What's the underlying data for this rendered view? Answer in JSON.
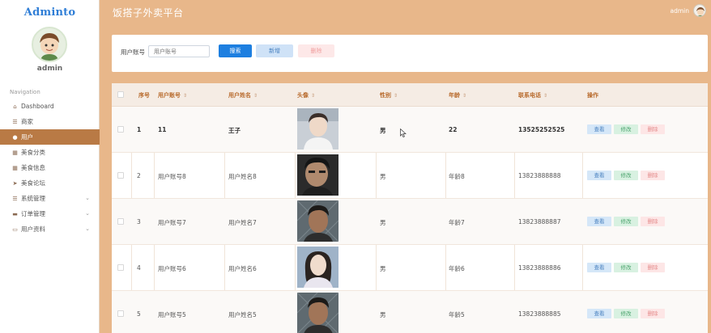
{
  "sidebar": {
    "brand": "Adminto",
    "admin_name": "admin",
    "nav_title": "Navigation",
    "items": [
      {
        "label": "Dashboard",
        "icon": "home-icon"
      },
      {
        "label": "商家",
        "icon": "list-icon"
      },
      {
        "label": "用户",
        "icon": "user-icon",
        "active": true
      },
      {
        "label": "美食分类",
        "icon": "grid-icon"
      },
      {
        "label": "美食信息",
        "icon": "grid-icon"
      },
      {
        "label": "美食论坛",
        "icon": "send-icon"
      },
      {
        "label": "系统管理",
        "icon": "list-icon",
        "expandable": true
      },
      {
        "label": "订单管理",
        "icon": "chat-icon",
        "expandable": true
      },
      {
        "label": "用户资料",
        "icon": "card-icon",
        "expandable": true
      }
    ]
  },
  "header": {
    "title": "饭搭子外卖平台",
    "username": "admin"
  },
  "search": {
    "label": "用户账号",
    "placeholder": "用户账号",
    "search_label": "搜索",
    "add_label": "新增",
    "delete_label": "删除"
  },
  "table": {
    "columns": [
      "序号",
      "用户账号",
      "用户姓名",
      "头像",
      "性别",
      "年龄",
      "联系电话",
      "操作"
    ],
    "actions": {
      "view": "查看",
      "edit": "修改",
      "remove": "删除"
    },
    "rows": [
      {
        "no": "1",
        "account": "11",
        "name": "王子",
        "gender": "男",
        "age": "22",
        "phone": "13525252525"
      },
      {
        "no": "2",
        "account": "用户账号8",
        "name": "用户姓名8",
        "gender": "男",
        "age": "年龄8",
        "phone": "13823888888"
      },
      {
        "no": "3",
        "account": "用户账号7",
        "name": "用户姓名7",
        "gender": "男",
        "age": "年龄7",
        "phone": "13823888887"
      },
      {
        "no": "4",
        "account": "用户账号6",
        "name": "用户姓名6",
        "gender": "男",
        "age": "年龄6",
        "phone": "13823888886"
      },
      {
        "no": "5",
        "account": "用户账号5",
        "name": "用户姓名5",
        "gender": "男",
        "age": "年龄5",
        "phone": "13823888885"
      }
    ]
  },
  "colors": {
    "accent": "#e8b78a",
    "active_nav": "#b97a45",
    "primary_button": "#1d7fe0",
    "header_text": "#b86a2c"
  }
}
